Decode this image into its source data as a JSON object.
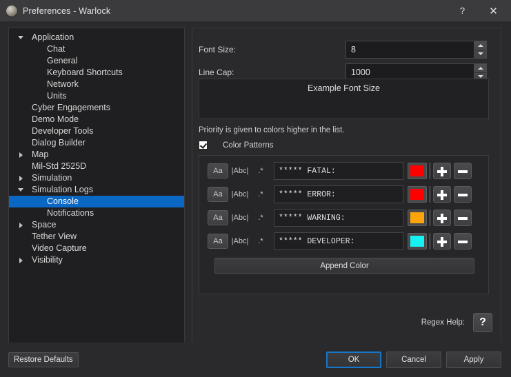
{
  "window": {
    "title": "Preferences - Warlock",
    "icon": "app-sphere-icon",
    "help_glyph": "?",
    "close_glyph": "✕"
  },
  "sidebar": {
    "items": [
      {
        "label": "Application",
        "level": 1,
        "expander": "down",
        "selected": false
      },
      {
        "label": "Chat",
        "level": 2,
        "expander": "none",
        "selected": false
      },
      {
        "label": "General",
        "level": 2,
        "expander": "none",
        "selected": false
      },
      {
        "label": "Keyboard Shortcuts",
        "level": 2,
        "expander": "none",
        "selected": false
      },
      {
        "label": "Network",
        "level": 2,
        "expander": "none",
        "selected": false
      },
      {
        "label": "Units",
        "level": 2,
        "expander": "none",
        "selected": false
      },
      {
        "label": "Cyber Engagements",
        "level": 1,
        "expander": "none",
        "selected": false
      },
      {
        "label": "Demo Mode",
        "level": 1,
        "expander": "none",
        "selected": false
      },
      {
        "label": "Developer Tools",
        "level": 1,
        "expander": "none",
        "selected": false
      },
      {
        "label": "Dialog Builder",
        "level": 1,
        "expander": "none",
        "selected": false
      },
      {
        "label": "Map",
        "level": 1,
        "expander": "right",
        "selected": false
      },
      {
        "label": "Mil-Std 2525D",
        "level": 1,
        "expander": "none",
        "selected": false
      },
      {
        "label": "Simulation",
        "level": 1,
        "expander": "right",
        "selected": false
      },
      {
        "label": "Simulation Logs",
        "level": 1,
        "expander": "down",
        "selected": false
      },
      {
        "label": "Console",
        "level": 2,
        "expander": "none",
        "selected": true
      },
      {
        "label": "Notifications",
        "level": 2,
        "expander": "none",
        "selected": false
      },
      {
        "label": "Space",
        "level": 1,
        "expander": "right",
        "selected": false
      },
      {
        "label": "Tether View",
        "level": 1,
        "expander": "none",
        "selected": false
      },
      {
        "label": "Video Capture",
        "level": 1,
        "expander": "none",
        "selected": false
      },
      {
        "label": "Visibility",
        "level": 1,
        "expander": "right",
        "selected": false
      }
    ]
  },
  "settings": {
    "font_size": {
      "label": "Font Size:",
      "value": "8"
    },
    "line_cap": {
      "label": "Line Cap:",
      "value": "1000"
    },
    "preview_text": "Example Font Size",
    "priority_note": "Priority is given to colors higher in the list.",
    "color_patterns_checkbox": {
      "label": "Color Patterns",
      "checked": true
    },
    "toggles": {
      "case_sensitive": "Aa",
      "whole_word": "|Abc|",
      "regex": ".*"
    },
    "patterns": [
      {
        "pattern": "***** FATAL:",
        "color": "#FF0000"
      },
      {
        "pattern": "***** ERROR:",
        "color": "#FF0000"
      },
      {
        "pattern": "***** WARNING:",
        "color": "#FFA50A"
      },
      {
        "pattern": "***** DEVELOPER:",
        "color": "#16F2F2"
      }
    ],
    "append_color_label": "Append Color",
    "regex_help": {
      "label": "Regex Help:",
      "glyph": "?"
    }
  },
  "footer": {
    "restore_defaults": "Restore Defaults",
    "ok": "OK",
    "cancel": "Cancel",
    "apply": "Apply"
  }
}
